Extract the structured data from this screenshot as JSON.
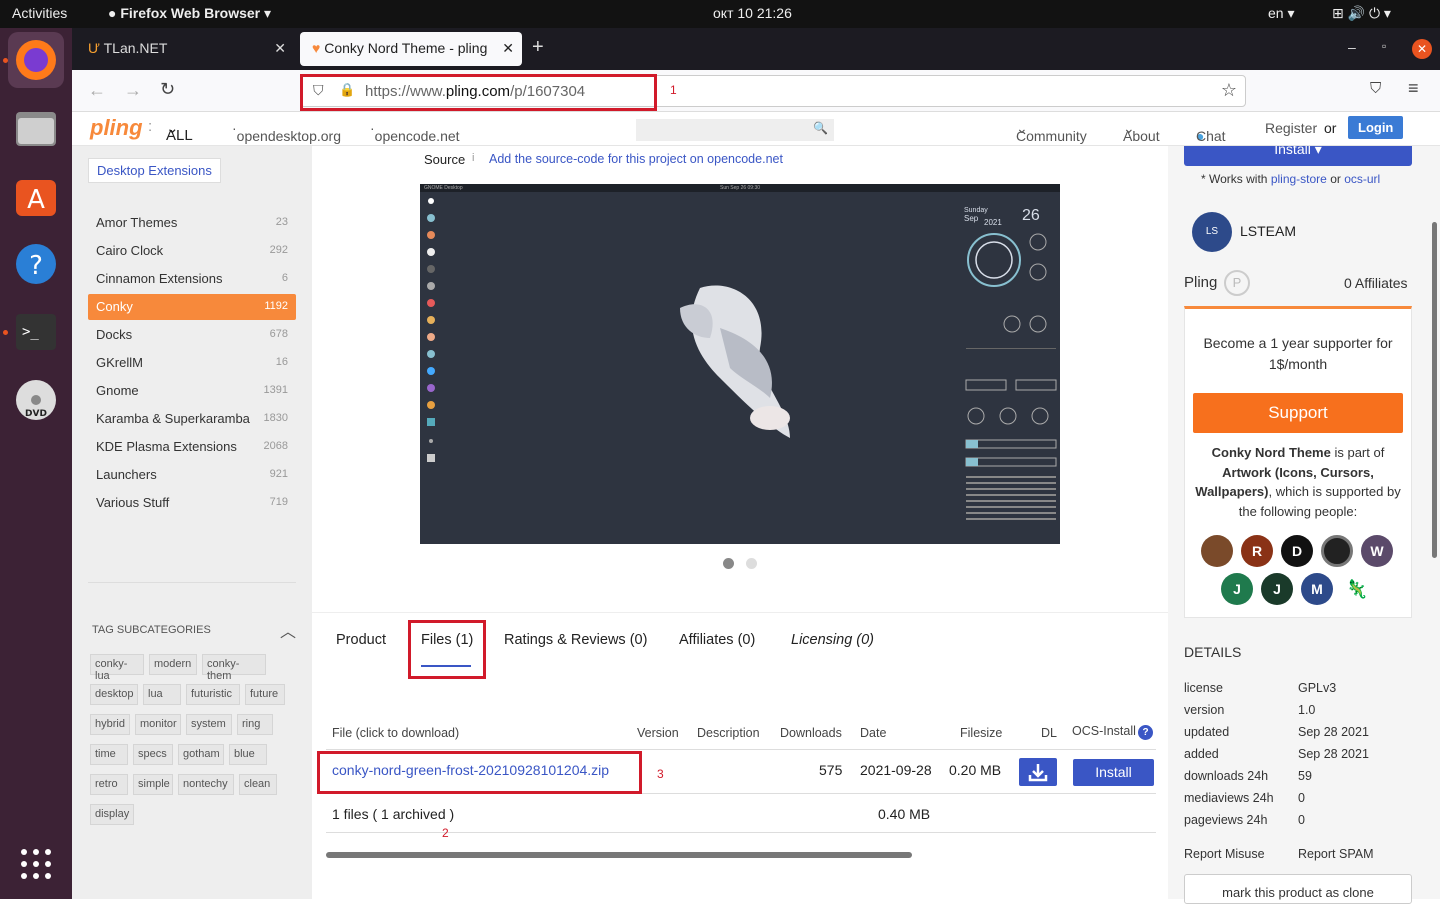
{
  "topbar": {
    "activities": "Activities",
    "app": "Firefox Web Browser",
    "clock": "окт 10  21:26",
    "lang": "en"
  },
  "tabs": [
    {
      "title": "TLan.NET"
    },
    {
      "title": "Conky Nord Theme - pling"
    }
  ],
  "url": {
    "prefix": "https://www.",
    "domain": "pling.com",
    "path": "/p/1607304"
  },
  "annotations": [
    "1",
    "2",
    "3"
  ],
  "site": {
    "logo": "pling",
    "filter": "ALL",
    "links": [
      "opendesktop.org",
      "opencode.net"
    ],
    "nav": [
      "Community",
      "About",
      "Chat",
      "Register",
      "or",
      "Login"
    ]
  },
  "sidebar": {
    "badge": "Desktop Extensions",
    "categories": [
      {
        "name": "Amor Themes",
        "count": "23"
      },
      {
        "name": "Cairo Clock",
        "count": "292"
      },
      {
        "name": "Cinnamon Extensions",
        "count": "6"
      },
      {
        "name": "Conky",
        "count": "1192"
      },
      {
        "name": "Docks",
        "count": "678"
      },
      {
        "name": "GKrellM",
        "count": "16"
      },
      {
        "name": "Gnome",
        "count": "1391"
      },
      {
        "name": "Karamba & Superkaramba",
        "count": "1830"
      },
      {
        "name": "KDE Plasma Extensions",
        "count": "2068"
      },
      {
        "name": "Launchers",
        "count": "921"
      },
      {
        "name": "Various Stuff",
        "count": "719"
      }
    ],
    "tag_title": "TAG SUBCATEGORIES",
    "tags": [
      "conky-lua",
      "modern",
      "conky-them",
      "desktop",
      "lua",
      "futuristic",
      "future",
      "hybrid",
      "monitor",
      "system",
      "ring",
      "time",
      "specs",
      "gotham",
      "blue",
      "retro",
      "simple",
      "nontechy",
      "clean",
      "display"
    ]
  },
  "main": {
    "source_label": "Source",
    "source_hint": "i",
    "source_link": "Add the source-code for this project on opencode.net",
    "screenshot": {
      "topbar": "GNOME Desktop",
      "date": "Sun Sep 26  09:30",
      "day": "Sunday",
      "month": "Sep",
      "year": "2021",
      "daynum": "26"
    },
    "tabs": [
      "Product",
      "Files (1)",
      "Ratings & Reviews (0)",
      "Affiliates (0)",
      "Licensing (0)"
    ],
    "table": {
      "headers": [
        "File (click to download)",
        "Version",
        "Description",
        "Downloads",
        "Date",
        "Filesize",
        "DL",
        "OCS-Install"
      ],
      "file": {
        "name": "conky-nord-green-frost-20210928101204.zip",
        "downloads": "575",
        "date": "2021-09-28",
        "size": "0.20 MB",
        "install": "Install"
      },
      "footer": {
        "count": "1 files ( 1 archived )",
        "total": "0.40 MB"
      }
    }
  },
  "right": {
    "install": "Install",
    "works": "* Works with",
    "ps": "pling-store",
    "or": "or",
    "ocs": "ocs-url",
    "author": "LSTEAM",
    "author_initials": "LS",
    "pling": "Pling",
    "aff": "0 Affiliates",
    "become": "Become a 1 year supporter for 1$/month",
    "support": "Support",
    "part_title": "Conky Nord Theme",
    "part_mid": "is part of",
    "part_cat": "Artwork (Icons, Cursors, Wallpapers)",
    "part_end": ", which is supported by the following people:",
    "supporters": [
      "R",
      "D",
      "W",
      "J",
      "J",
      "M"
    ],
    "details_title": "DETAILS",
    "details": [
      [
        "license",
        "GPLv3"
      ],
      [
        "version",
        "1.0"
      ],
      [
        "updated",
        "Sep 28 2021"
      ],
      [
        "added",
        "Sep 28 2021"
      ],
      [
        "downloads 24h",
        "59"
      ],
      [
        "mediaviews 24h",
        "0"
      ],
      [
        "pageviews 24h",
        "0"
      ]
    ],
    "report_misuse": "Report Misuse",
    "report_spam": "Report SPAM",
    "clone": "mark this product as clone"
  },
  "colors": {
    "accent": "#f7893b",
    "link": "#3a56c5",
    "red": "#d11a2a"
  }
}
